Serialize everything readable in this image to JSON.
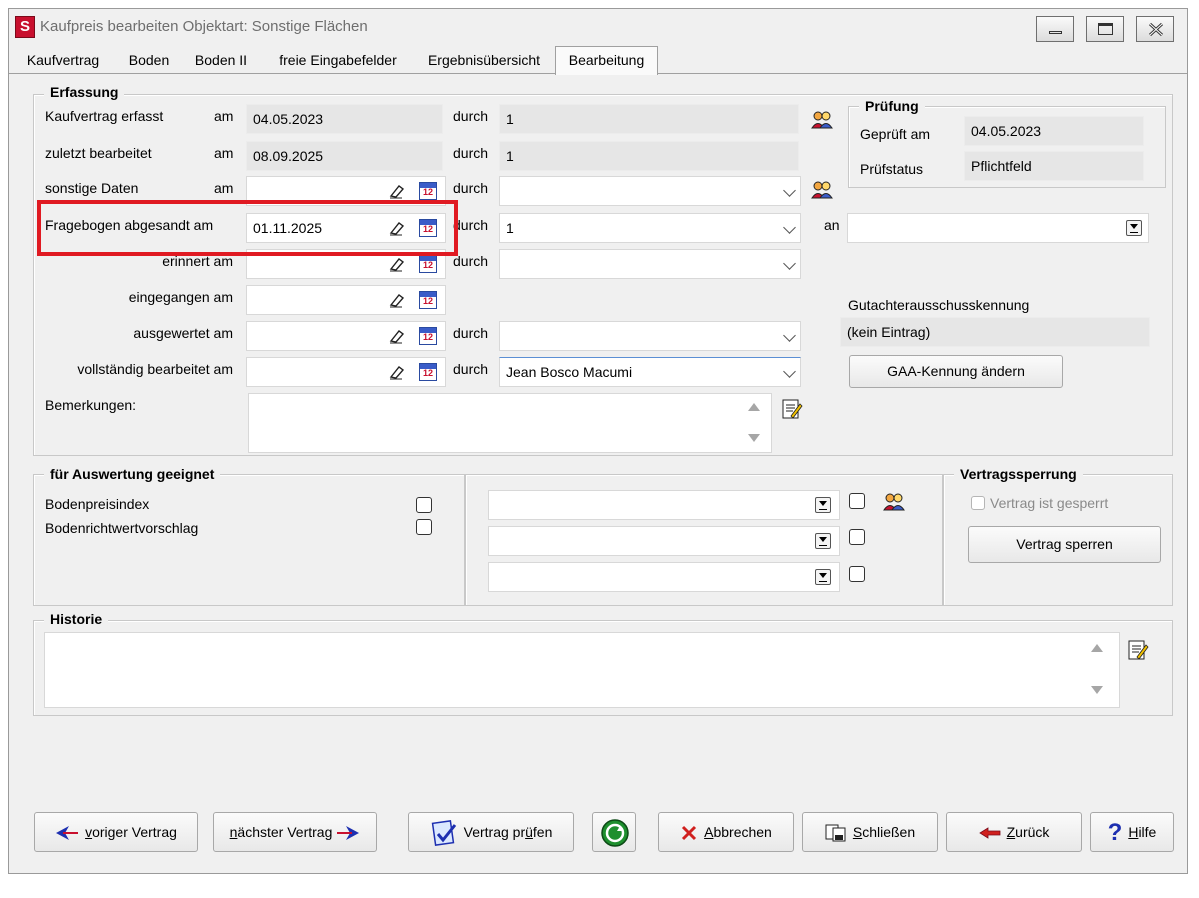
{
  "window": {
    "app_letter": "S",
    "title": "Kaufpreis bearbeiten  Objektart: Sonstige Flächen"
  },
  "tabs": [
    "Kaufvertrag",
    "Boden",
    "Boden II",
    "freie Eingabefelder",
    "Ergebnisübersicht",
    "Bearbeitung"
  ],
  "active_tab": "Bearbeitung",
  "erfassung": {
    "title": "Erfassung",
    "am": "am",
    "durch": "durch",
    "rows": {
      "kaufvertrag_erfasst": {
        "label": "Kaufvertrag erfasst",
        "date": "04.05.2023",
        "durch": "1"
      },
      "zuletzt_bearbeitet": {
        "label": "zuletzt bearbeitet",
        "date": "08.09.2025",
        "durch": "1"
      },
      "sonstige_daten": {
        "label": "sonstige Daten",
        "date": "",
        "durch": ""
      },
      "fragebogen": {
        "label": "Fragebogen abgesandt am",
        "date": "01.11.2025",
        "durch": "1",
        "an_label": "an",
        "an": ""
      },
      "erinnert": {
        "label": "erinnert am",
        "date": "",
        "durch": ""
      },
      "eingegangen": {
        "label": "eingegangen am",
        "date": ""
      },
      "ausgewertet": {
        "label": "ausgewertet am",
        "date": "",
        "durch": ""
      },
      "vollstaendig": {
        "label": "vollständig bearbeitet am",
        "date": "",
        "durch": "Jean Bosco Macumi"
      }
    },
    "bemerkungen_label": "Bemerkungen:",
    "bemerkungen": ""
  },
  "pruefung": {
    "title": "Prüfung",
    "geprueft_label": "Geprüft am",
    "geprueft": "04.05.2023",
    "status_label": "Prüfstatus",
    "status": "Pflichtfeld"
  },
  "gaa": {
    "label": "Gutachterausschusskennung",
    "value": "(kein Eintrag)",
    "button": "GAA-Kennung ändern"
  },
  "auswertung": {
    "title": "für Auswertung geeignet",
    "items": [
      "Bodenpreisindex",
      "Bodenrichtwertvorschlag"
    ]
  },
  "sperrung": {
    "title": "Vertragssperrung",
    "checkbox": "Vertrag ist gesperrt",
    "button": "Vertrag sperren"
  },
  "historie": {
    "title": "Historie",
    "text": ""
  },
  "footer": {
    "prev_u": "v",
    "prev_rest": "origer Vertrag",
    "next_u": "n",
    "next_rest": "ächster Vertrag",
    "pruefen_pre": "Vertrag pr",
    "pruefen_u": "ü",
    "pruefen_rest": "fen",
    "abbrechen_u": "A",
    "abbrechen_rest": "bbrechen",
    "schliessen_u": "S",
    "schliessen_rest": "chließen",
    "zurueck_u": "Z",
    "zurueck_rest": "urück",
    "hilfe_u": "H",
    "hilfe_rest": "ilfe"
  },
  "colors": {
    "highlight": "#e01a22",
    "app_logo": "#c8102e",
    "window_bg": "#f0f0f0",
    "readonly_bg": "#e6e6e6"
  }
}
